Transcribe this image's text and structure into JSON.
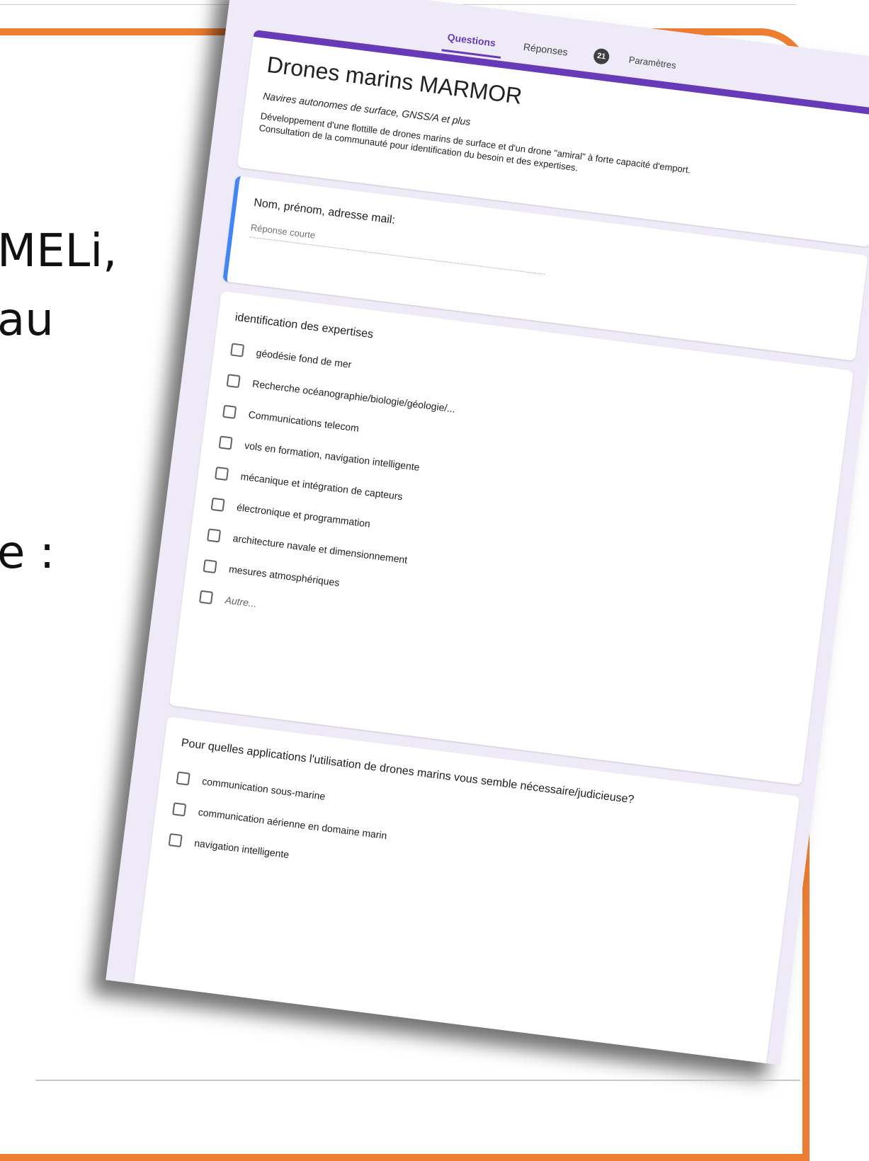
{
  "slide": {
    "fragments": [
      "MELi,",
      "au",
      "e :"
    ]
  },
  "form": {
    "tabs": {
      "questions": "Questions",
      "responses": "Réponses",
      "responses_count": "21",
      "settings": "Paramètres"
    },
    "title": "Drones marins MARMOR",
    "subtitle": "Navires autonomes de surface, GNSS/A et plus",
    "description_line1": "Développement d'une flottille de drones marins de surface et d'un drone \"amiral\" à forte capacité d'emport.",
    "description_line2": "Consultation de la communauté pour identification du besoin et des expertises.",
    "q1": {
      "label": "Nom, prénom, adresse mail:",
      "placeholder": "Réponse courte"
    },
    "q2": {
      "label": "identification des expertises",
      "options": [
        "géodésie fond de mer",
        "Recherche océanographie/biologie/géologie/...",
        "Communications telecom",
        "vols en formation, navigation intelligente",
        "mécanique et intégration de capteurs",
        "électronique et programmation",
        "architecture navale et dimensionnement",
        "mesures atmosphériques"
      ],
      "other": "Autre..."
    },
    "q3": {
      "label": "Pour quelles applications l'utilisation de drones marins vous semble nécessaire/judicieuse?",
      "options": [
        "communication sous-marine",
        "communication aérienne en domaine marin",
        "navigation intelligente"
      ]
    }
  },
  "colors": {
    "slide_accent": "#ED7D31",
    "form_accent": "#673AB7",
    "active_question": "#4285F4"
  }
}
